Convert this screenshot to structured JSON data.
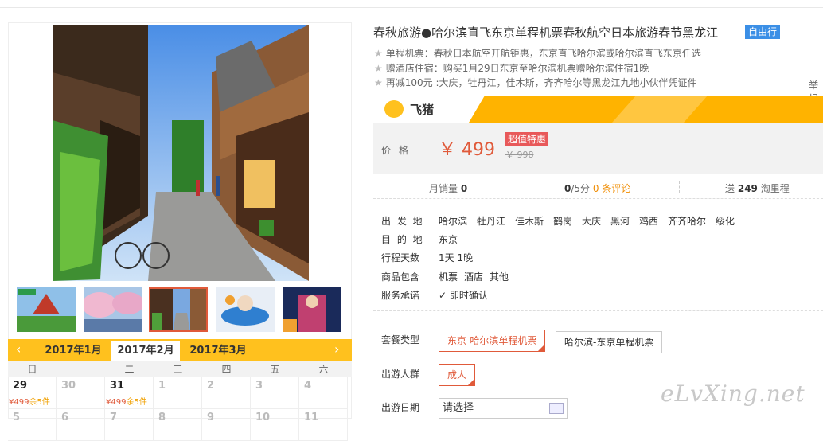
{
  "product": {
    "title": "春秋旅游●哈尔滨直飞东京单程机票春秋航空日本旅游春节黑龙江",
    "tag": "自由行",
    "promos": [
      "单程机票：春秋日本航空开航钜惠，东京直飞哈尔滨或哈尔滨直飞东京任选",
      "赠酒店住宿：购买1月29日东京至哈尔滨机票赠哈尔滨住宿1晚",
      "再减100元 :大庆，牡丹江，佳木斯，齐齐哈尔等黑龙江九地小伙伴凭证件"
    ],
    "report_label": "举报"
  },
  "shop": {
    "name": "飞猪"
  },
  "price": {
    "label": "价格",
    "value": "￥ 499",
    "badge": "超值特惠",
    "original": "￥ 998"
  },
  "stats": {
    "monthly_sales_label": "月销量",
    "monthly_sales": "0",
    "rating": "0",
    "rating_suffix": "/5分",
    "reviews": "0 条评论",
    "points_prefix": "送",
    "points": "249",
    "points_suffix": "淘里程"
  },
  "attributes": {
    "departure_label": "出 发 地",
    "departure_cities": [
      "哈尔滨",
      "牡丹江",
      "佳木斯",
      "鹤岗",
      "大庆",
      "黑河",
      "鸡西",
      "齐齐哈尔",
      "绥化"
    ],
    "destination_label": "目 的 地",
    "destination": "东京",
    "days_label": "行程天数",
    "days": "1天 1晚",
    "includes_label": "商品包含",
    "includes": [
      "机票",
      "酒店",
      "其他"
    ],
    "promise_label": "服务承诺",
    "promise": "即时确认"
  },
  "options": {
    "package_label": "套餐类型",
    "packages": [
      "东京-哈尔滨单程机票",
      "哈尔滨-东京单程机票"
    ],
    "traveler_label": "出游人群",
    "traveler": "成人",
    "date_label": "出游日期",
    "date_placeholder": "请选择"
  },
  "calendar": {
    "months": [
      "2017年1月",
      "2017年2月",
      "2017年3月"
    ],
    "weekdays": [
      "日",
      "一",
      "二",
      "三",
      "四",
      "五",
      "六"
    ],
    "row1": [
      {
        "d": "29",
        "price": "¥499",
        "stock": "余5件"
      },
      {
        "d": "30"
      },
      {
        "d": "31",
        "price": "¥499",
        "stock": "余5件"
      },
      {
        "d": "1"
      },
      {
        "d": "2"
      },
      {
        "d": "3"
      },
      {
        "d": "4"
      }
    ],
    "row2": [
      "5",
      "6",
      "7",
      "8",
      "9",
      "10",
      "11"
    ]
  },
  "watermark": "eLvXing.net",
  "colors": {
    "accent": "#e05a3a",
    "brand_yellow": "#ffc11e",
    "tag_blue": "#3b8fe6"
  }
}
